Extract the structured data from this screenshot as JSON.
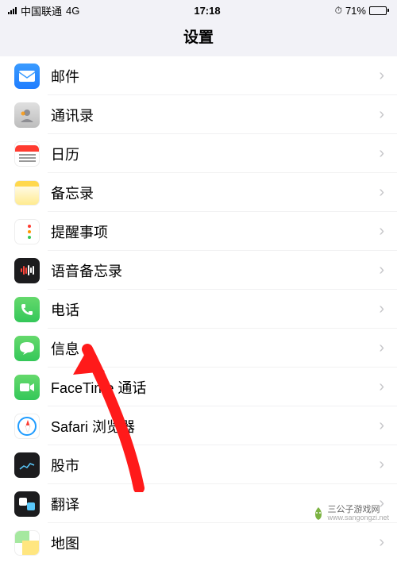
{
  "status": {
    "carrier": "中国联通",
    "network": "4G",
    "time": "17:18",
    "battery_pct": "71%"
  },
  "nav": {
    "title": "设置"
  },
  "rows": [
    {
      "key": "mail",
      "label": "邮件"
    },
    {
      "key": "contacts",
      "label": "通讯录"
    },
    {
      "key": "calendar",
      "label": "日历"
    },
    {
      "key": "notes",
      "label": "备忘录"
    },
    {
      "key": "reminders",
      "label": "提醒事项"
    },
    {
      "key": "voicememo",
      "label": "语音备忘录"
    },
    {
      "key": "phone",
      "label": "电话"
    },
    {
      "key": "messages",
      "label": "信息"
    },
    {
      "key": "facetime",
      "label": "FaceTime 通话"
    },
    {
      "key": "safari",
      "label": "Safari 浏览器"
    },
    {
      "key": "stocks",
      "label": "股市"
    },
    {
      "key": "translate",
      "label": "翻译"
    },
    {
      "key": "maps",
      "label": "地图"
    }
  ],
  "annotation": {
    "arrow_target_row": "messages"
  },
  "watermark": {
    "text": "三公子游戏网",
    "url": "www.sangongzi.net"
  }
}
